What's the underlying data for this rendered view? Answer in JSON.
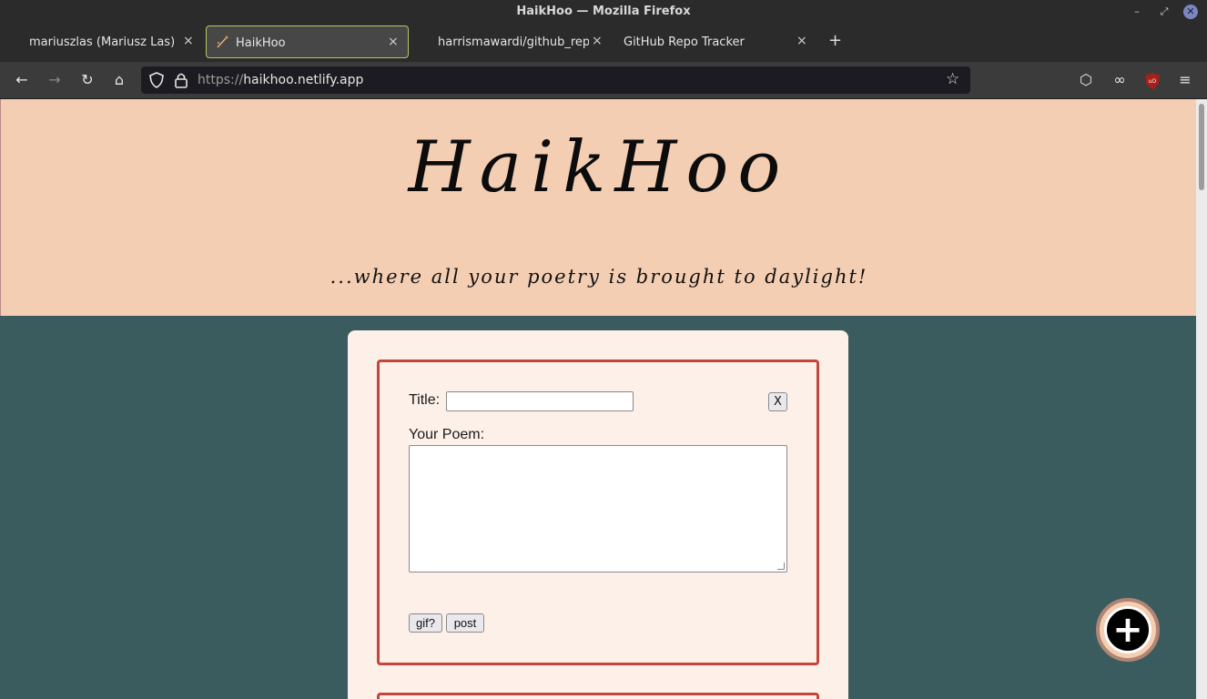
{
  "window": {
    "title": "HaikHoo — Mozilla Firefox",
    "minimize": "–",
    "maximize": "⤢",
    "close": "✕"
  },
  "tabs": [
    {
      "label": "mariuszlas (Mariusz Las)",
      "close": "×"
    },
    {
      "label": "HaikHoo",
      "close": "×"
    },
    {
      "label": "harrismawardi/github_repo",
      "close": "×"
    },
    {
      "label": "GitHub Repo Tracker",
      "close": "×"
    }
  ],
  "new_tab": "+",
  "nav": {
    "back": "←",
    "forward": "→",
    "reload": "↻",
    "home": "⌂",
    "url_scheme": "https://",
    "url_host": "haikhoo.netlify.app",
    "bookmark": "☆",
    "pocket": "⬡",
    "ext_mask": "∞",
    "menu": "≡"
  },
  "page": {
    "site_title": "HaikHoo",
    "tagline": "...where all your poetry is brought to daylight!",
    "form": {
      "title_label": "Title:",
      "title_value": "",
      "close_button": "X",
      "poem_label": "Your Poem:",
      "poem_value": "",
      "gif_button": "gif?",
      "post_button": "post"
    },
    "fab_symbol": "+"
  },
  "colors": {
    "header_bg": "#f4ceb3",
    "page_bg": "#3b5c5e",
    "card_bg": "#fdf0e8",
    "form_border": "#c4453b",
    "tab_active_border": "#b6c760"
  }
}
